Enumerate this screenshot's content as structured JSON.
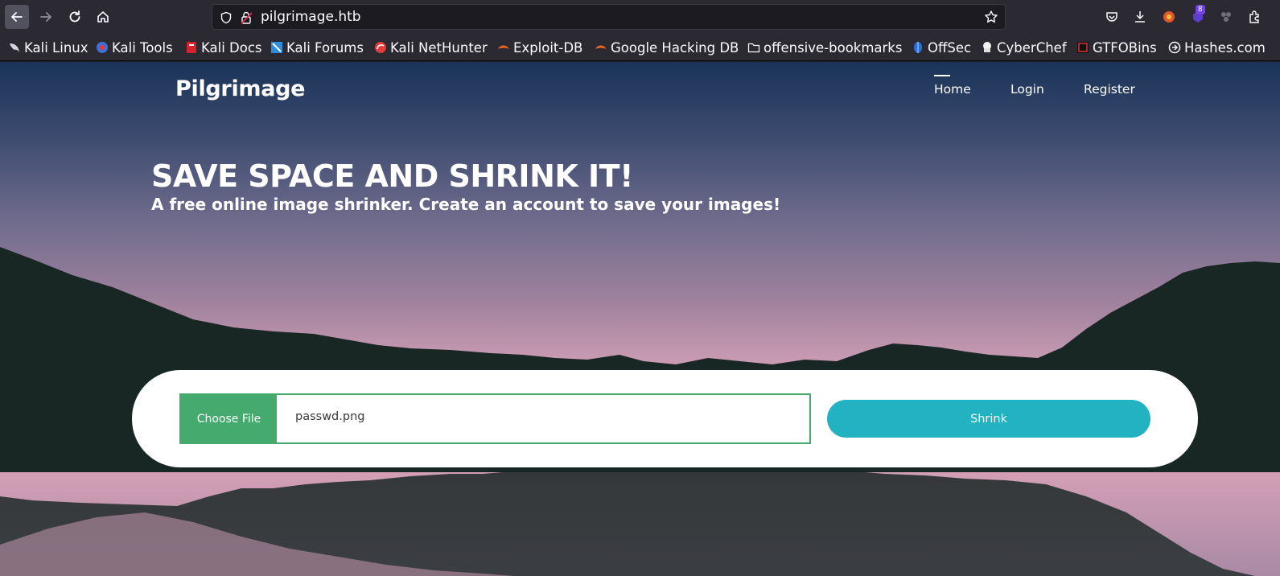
{
  "browser": {
    "url": "pilgrimage.htb",
    "extension_badge": "8",
    "colors": {
      "chrome": "#2b2a33",
      "urlbar": "#1c1b22",
      "text": "#fbfbfe"
    },
    "bookmarks": [
      {
        "label": "Kali Linux",
        "icon": "kali-dragon-icon"
      },
      {
        "label": "Kali Tools",
        "icon": "kali-tools-icon"
      },
      {
        "label": "Kali Docs",
        "icon": "kali-docs-icon"
      },
      {
        "label": "Kali Forums",
        "icon": "kali-forums-icon"
      },
      {
        "label": "Kali NetHunter",
        "icon": "nethunter-icon"
      },
      {
        "label": "Exploit-DB",
        "icon": "exploit-db-icon"
      },
      {
        "label": "Google Hacking DB",
        "icon": "ghdb-icon"
      },
      {
        "label": "offensive-bookmarks",
        "icon": "folder-icon"
      },
      {
        "label": "OffSec",
        "icon": "offsec-icon"
      },
      {
        "label": "CyberChef",
        "icon": "cyberchef-icon"
      },
      {
        "label": "GTFOBins",
        "icon": "gtfobins-icon"
      },
      {
        "label": "Hashes.com",
        "icon": "hashes-icon"
      }
    ]
  },
  "site": {
    "brand": "Pilgrimage",
    "nav": [
      {
        "label": "Home",
        "active": true
      },
      {
        "label": "Login",
        "active": false
      },
      {
        "label": "Register",
        "active": false
      }
    ],
    "hero": {
      "title": "SAVE SPACE AND SHRINK IT!",
      "subtitle": "A free online image shrinker. Create an account to save your images!"
    },
    "upload": {
      "choose_label": "Choose File",
      "file_name": "passwd.png",
      "submit_label": "Shrink"
    },
    "colors": {
      "choose": "#44aa6e",
      "shrink": "#22b2c2",
      "mountains": "#182624"
    }
  }
}
